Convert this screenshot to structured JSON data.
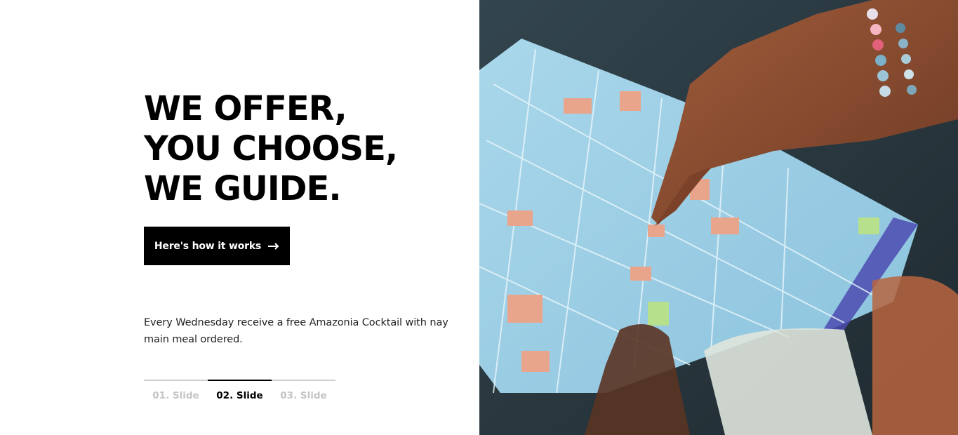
{
  "hero": {
    "headline_lines": [
      "WE OFFER,",
      "YOU CHOOSE,",
      "WE GUIDE."
    ],
    "cta_label": "Here's how it works",
    "cta_icon": "arrow-right-icon",
    "promo_text": "Every Wednesday receive a free Amazonia Cocktail with nay main meal ordered."
  },
  "slider": {
    "tabs": [
      {
        "label": "01. Slide",
        "active": false
      },
      {
        "label": "02. Slide",
        "active": true
      },
      {
        "label": "03. Slide",
        "active": false
      }
    ]
  },
  "image": {
    "subject": "hand-pointing-at-city-map",
    "colors": {
      "map_blue": "#9ccfe6",
      "map_building": "#e8a58c",
      "skin": "#8a4d32",
      "background": "#2b3a41"
    }
  }
}
